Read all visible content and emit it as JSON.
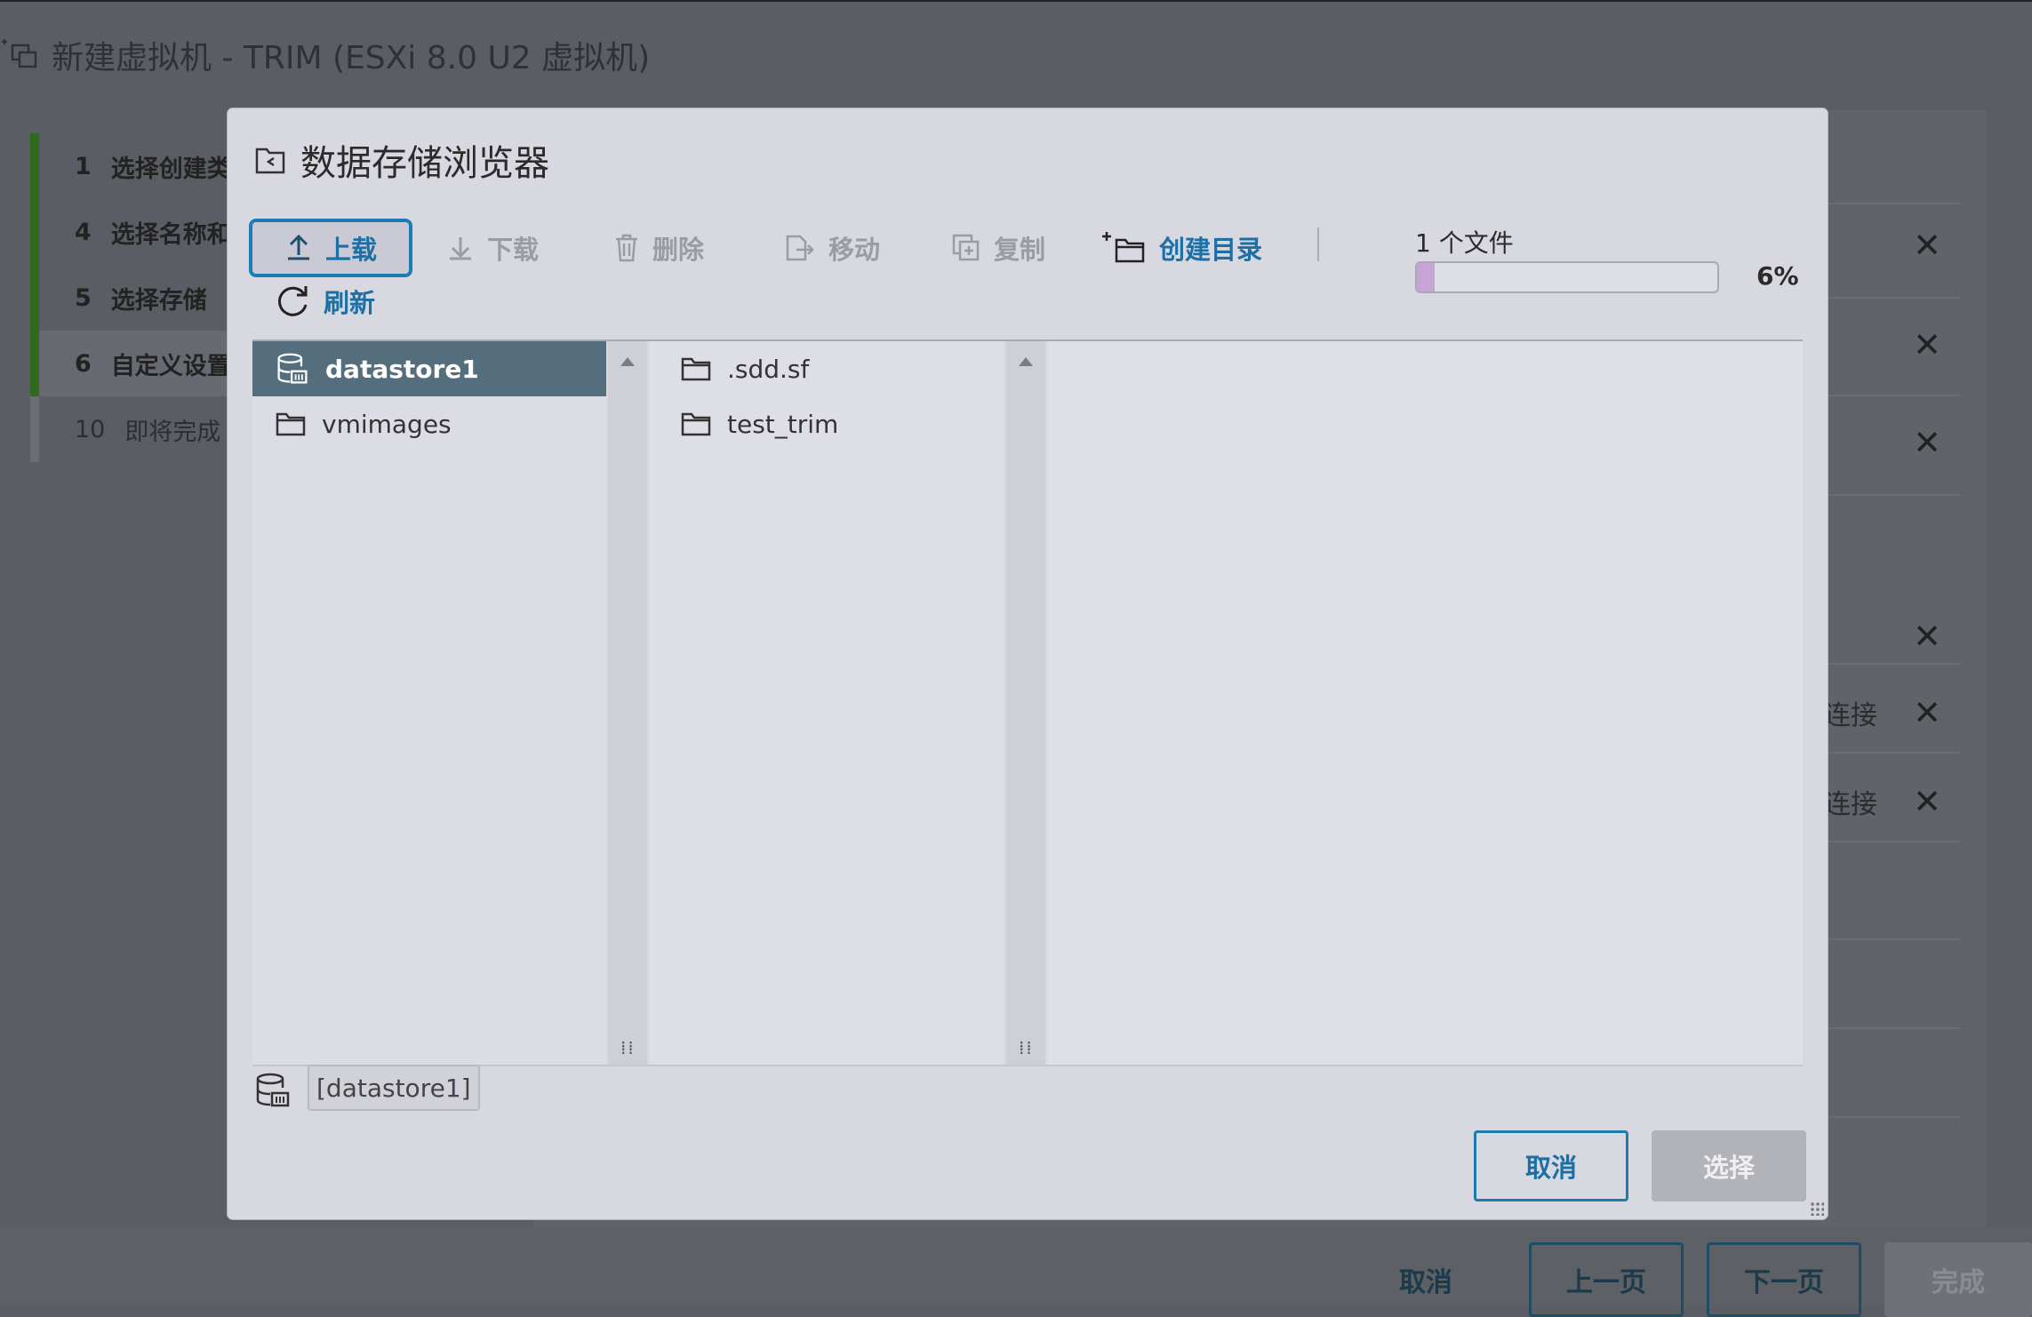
{
  "wizard": {
    "title": "新建虚拟机 - TRIM (ESXi 8.0 U2 虚拟机)",
    "steps": [
      {
        "num": "1",
        "label": "选择创建类"
      },
      {
        "num": "4",
        "label": "选择名称和"
      },
      {
        "num": "5",
        "label": "选择存储"
      },
      {
        "num": "6",
        "label": "自定义设置"
      },
      {
        "num": "10",
        "label": "即将完成"
      }
    ],
    "connect_label_1": "连接",
    "connect_label_2": "连接",
    "footer": {
      "cancel": "取消",
      "prev": "上一页",
      "next": "下一页",
      "finish": "完成"
    }
  },
  "dialog": {
    "title": "数据存储浏览器",
    "toolbar": {
      "upload": "上载",
      "download": "下载",
      "delete": "删除",
      "move": "移动",
      "copy": "复制",
      "mkdir": "创建目录",
      "refresh": "刷新"
    },
    "upload_status": {
      "label": "1 个文件",
      "percent_text": "6%",
      "progress": 0.06
    },
    "column1": [
      {
        "name": "datastore1",
        "icon": "datastore-icon",
        "selected": true
      },
      {
        "name": "vmimages",
        "icon": "folder-icon",
        "selected": false
      }
    ],
    "column2": [
      {
        "name": ".sdd.sf",
        "icon": "folder-icon"
      },
      {
        "name": "test_trim",
        "icon": "folder-icon"
      }
    ],
    "path": "[datastore1]",
    "buttons": {
      "cancel": "取消",
      "select": "选择"
    },
    "colors": {
      "accent": "#1e6fa3",
      "selected_row": "#556e7e",
      "progress_fill": "#c8a4d6"
    }
  }
}
